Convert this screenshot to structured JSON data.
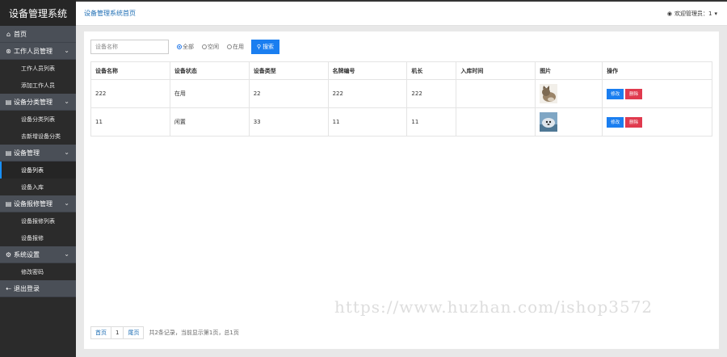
{
  "app": {
    "title": "设备管理系统"
  },
  "sidebar": {
    "home": "首页",
    "groups": [
      {
        "label": "工作人员管理",
        "icon": "user-circle-icon",
        "items": [
          "工作人员列表",
          "添加工作人员"
        ]
      },
      {
        "label": "设备分类管理",
        "icon": "document-icon",
        "items": [
          "设备分类列表",
          "去新增设备分类"
        ]
      },
      {
        "label": "设备管理",
        "icon": "document-icon",
        "items": [
          "设备列表",
          "设备入库"
        ]
      },
      {
        "label": "设备报修管理",
        "icon": "document-icon",
        "items": [
          "设备报修列表",
          "设备报修"
        ]
      },
      {
        "label": "系统设置",
        "icon": "gear-icon",
        "items": [
          "修改密码"
        ]
      }
    ],
    "logout": "退出登录",
    "active_item": "设备列表"
  },
  "header": {
    "breadcrumb": "设备管理系统首页",
    "welcome": "欢迎管理员：1"
  },
  "search": {
    "placeholder": "设备名称",
    "radio_options": [
      "全部",
      "空闲",
      "在用"
    ],
    "selected_radio": "全部",
    "button_label": "搜索"
  },
  "table": {
    "columns": [
      "设备名称",
      "设备状态",
      "设备类型",
      "名牌编号",
      "机长",
      "入库时间",
      "图片",
      "操作"
    ],
    "rows": [
      {
        "name": "222",
        "status": "在用",
        "type": "22",
        "plate": "222",
        "captain": "222",
        "stock_time": "",
        "image": "cat-thumbnail"
      },
      {
        "name": "11",
        "status": "闲置",
        "type": "33",
        "plate": "11",
        "captain": "11",
        "stock_time": "",
        "image": "seal-thumbnail"
      }
    ],
    "edit_label": "修改",
    "delete_label": "删除"
  },
  "pagination": {
    "first": "首页",
    "page": "1",
    "last": "尾页",
    "info": "共2条记录，当前显示第1页，总1页"
  },
  "watermark": "https://www.huzhan.com/ishop3572",
  "colors": {
    "primary": "#1a7ef0",
    "danger": "#e03a4e",
    "sidebar_bg": "#2b2b2b",
    "sidebar_head": "#4a4f57"
  }
}
